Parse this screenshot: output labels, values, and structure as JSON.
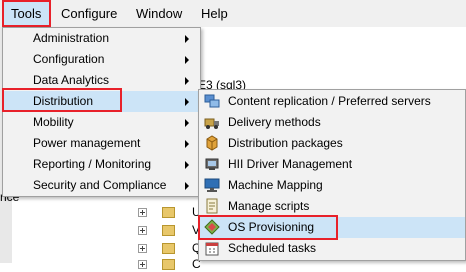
{
  "menubar": {
    "items": [
      {
        "label": "Tools"
      },
      {
        "label": "Configure"
      },
      {
        "label": "Window"
      },
      {
        "label": "Help"
      }
    ]
  },
  "background": {
    "server_fragment": "E3 (sql3)",
    "side_fragment": "nce",
    "tree_letters": [
      "U",
      "V",
      "Q",
      "C"
    ]
  },
  "tools_menu": {
    "items": [
      {
        "label": "Administration"
      },
      {
        "label": "Configuration"
      },
      {
        "label": "Data Analytics"
      },
      {
        "label": "Distribution"
      },
      {
        "label": "Mobility"
      },
      {
        "label": "Power management"
      },
      {
        "label": "Reporting / Monitoring"
      },
      {
        "label": "Security and Compliance"
      }
    ]
  },
  "distribution_menu": {
    "items": [
      {
        "label": "Content replication / Preferred servers",
        "icon": "content-replication-icon"
      },
      {
        "label": "Delivery methods",
        "icon": "delivery-methods-icon"
      },
      {
        "label": "Distribution packages",
        "icon": "distribution-packages-icon"
      },
      {
        "label": "HII Driver Management",
        "icon": "hii-driver-icon"
      },
      {
        "label": "Machine Mapping",
        "icon": "machine-mapping-icon"
      },
      {
        "label": "Manage scripts",
        "icon": "manage-scripts-icon"
      },
      {
        "label": "OS Provisioning",
        "icon": "os-provisioning-icon"
      },
      {
        "label": "Scheduled tasks",
        "icon": "scheduled-tasks-icon"
      }
    ]
  },
  "colors": {
    "highlight": "#cce4f7",
    "annotation_red": "#e8212a"
  }
}
